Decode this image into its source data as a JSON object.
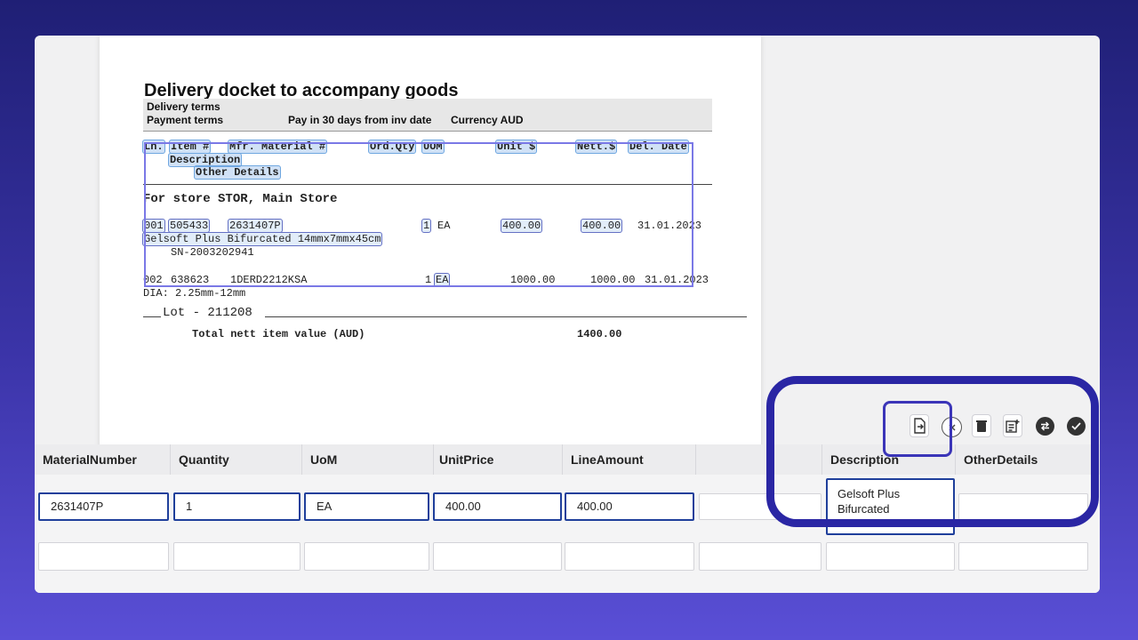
{
  "document": {
    "title": "Delivery docket to accompany goods",
    "delivery_terms_label": "Delivery terms",
    "payment_terms_label": "Payment terms",
    "payment_terms_value": "Pay in 30 days from inv date",
    "currency": "Currency AUD",
    "header_cols": {
      "ln": "Ln.",
      "item": "Item #",
      "mfr": "Mfr. Material #",
      "ordqty": "Ord.Qty",
      "uom": "UOM",
      "unit": "Unit $",
      "nett": "Nett.$",
      "del_date": "Del. Date",
      "description": "Description",
      "other_details": "Other Details"
    },
    "store_line": "For store STOR, Main Store",
    "line1": {
      "ln": "001",
      "item": "505433",
      "mfr": "2631407P",
      "qty": "1",
      "uom": "EA",
      "unit": "400.00",
      "nett": "400.00",
      "date": "31.01.2023",
      "description": "Gelsoft Plus Bifurcated 14mmx7mmx45cm",
      "serial": "SN-2003202941"
    },
    "line2": {
      "ln": "002",
      "item": "638623",
      "mfr": "1DERD2212KSA",
      "qty": "1",
      "uom": "EA",
      "unit": "1000.00",
      "nett": "1000.00",
      "date": "31.01.2023",
      "dia": "DIA: 2.25mm-12mm"
    },
    "lot": "Lot - 211208",
    "total_label": "Total nett item value (AUD)",
    "total_value": "1400.00"
  },
  "toolbar": {
    "icons": [
      "file-import-icon",
      "close-circle-icon",
      "trash-icon",
      "add-note-icon",
      "swap-icon",
      "check-circle-icon"
    ]
  },
  "grid": {
    "columns": [
      "MaterialNumber",
      "Quantity",
      "UoM",
      "UnitPrice",
      "LineAmount",
      "",
      "Description",
      "OtherDetails"
    ],
    "row1": {
      "MaterialNumber": "2631407P",
      "Quantity": "1",
      "UoM": "EA",
      "UnitPrice": "400.00",
      "LineAmount": "400.00",
      "Empty": "",
      "Description": "Gelsoft Plus Bifurcated",
      "OtherDetails": ""
    }
  },
  "colors": {
    "accent": "#2a26a4",
    "cell_active_border": "#1f3f9b",
    "highlight": "#6fa7e0"
  }
}
